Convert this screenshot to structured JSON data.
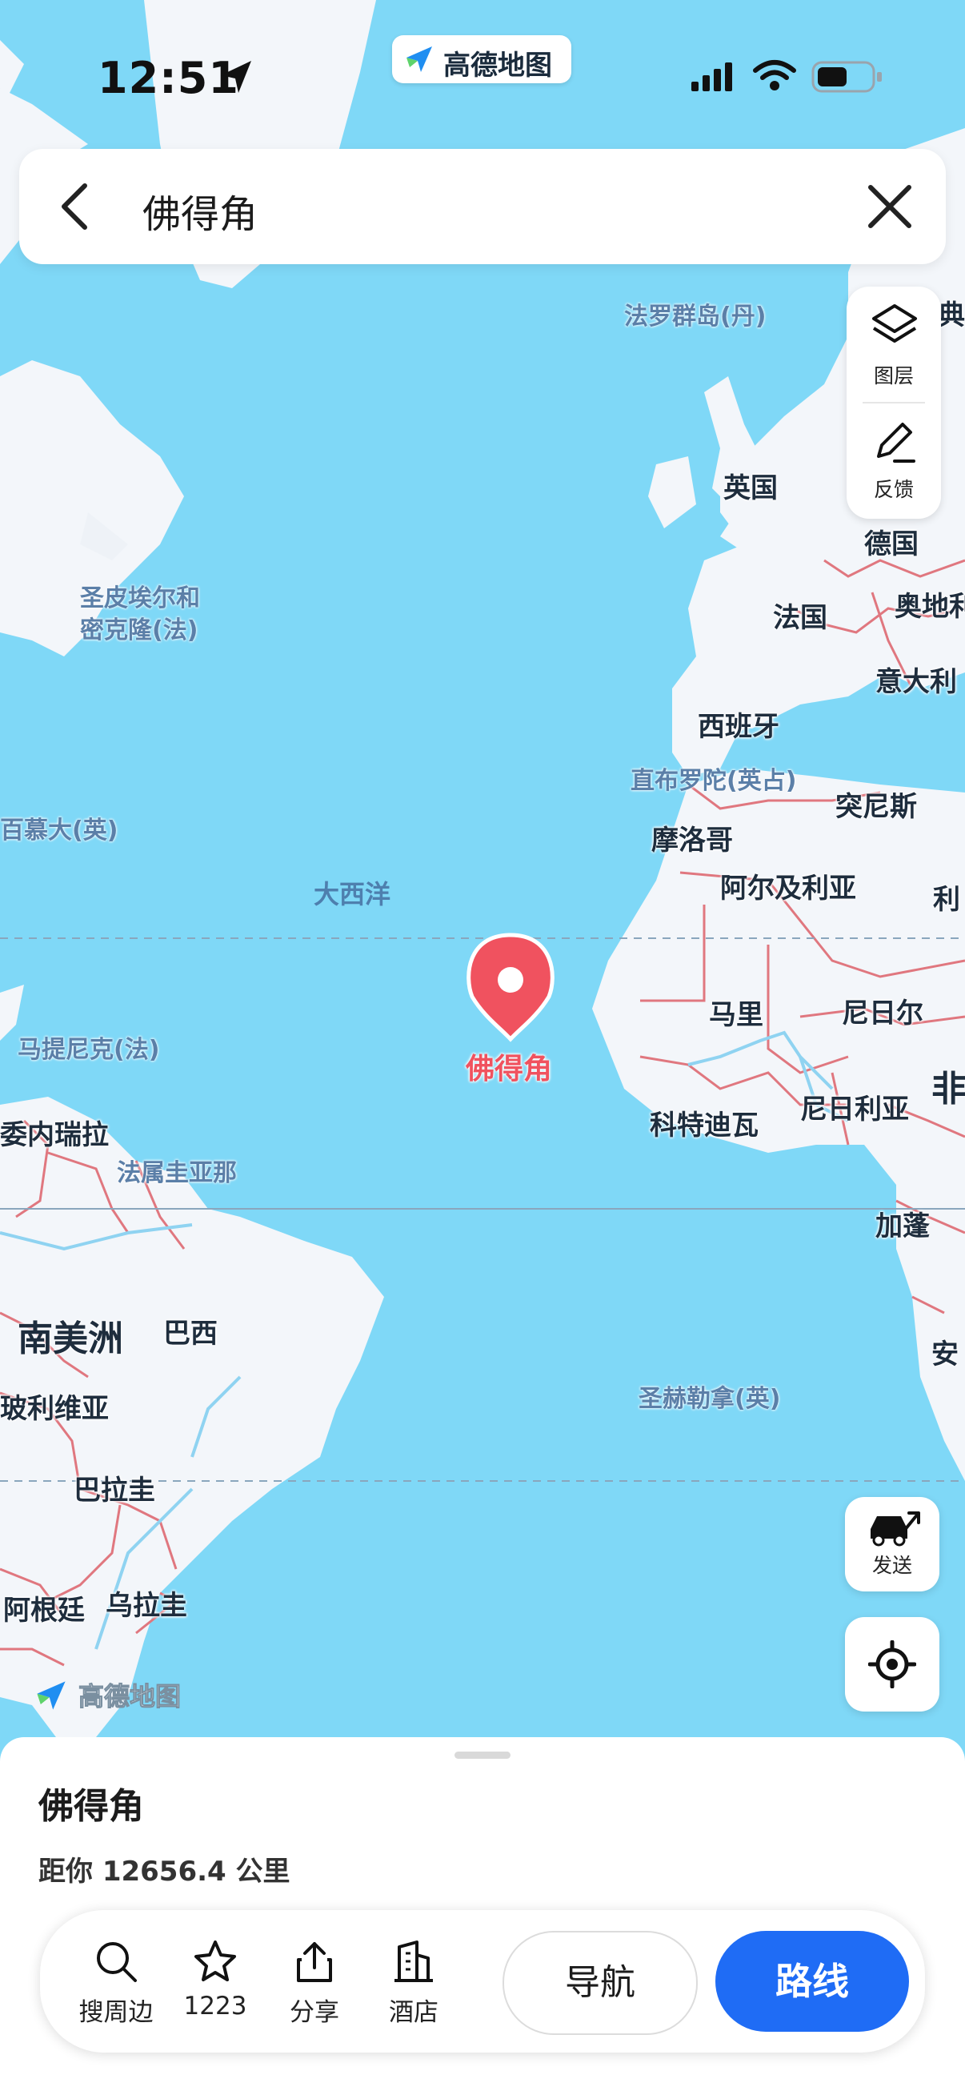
{
  "status_bar": {
    "time": "12:51",
    "app_name": "高德地图",
    "icons": [
      "location-arrow-icon",
      "signal-icon",
      "wifi-icon",
      "battery-icon"
    ]
  },
  "search": {
    "query": "佛得角",
    "back_icon": "chevron-left-icon",
    "clear_icon": "close-icon"
  },
  "side_tools": [
    {
      "label": "图层",
      "icon": "layers-icon"
    },
    {
      "label": "反馈",
      "icon": "pencil-icon"
    }
  ],
  "map_labels": {
    "faroe": "法罗群岛(丹)",
    "uk": "英国",
    "sweden_partial": "典",
    "germany": "德国",
    "austria": "奥地利",
    "france": "法国",
    "italy": "意大利",
    "spain": "西班牙",
    "gibraltar": "直布罗陀(英占)",
    "tunisia": "突尼斯",
    "morocco": "摩洛哥",
    "algeria": "阿尔及利亚",
    "libya_partial": "利",
    "mali": "马里",
    "niger": "尼日尔",
    "nigeria": "尼日利亚",
    "cote_divoire": "科特迪瓦",
    "africa_partial": "非",
    "gabon": "加蓬",
    "angola_partial": "安",
    "spm": "圣皮埃尔和\n密克隆(法)",
    "bermuda": "百慕大(英)",
    "atlantic": "大西洋",
    "martinique": "马提尼克(法)",
    "venezuela": "委内瑞拉",
    "french_guiana": "法属圭亚那",
    "south_america": "南美洲",
    "brazil": "巴西",
    "bolivia": "玻利维亚",
    "paraguay": "巴拉圭",
    "argentina": "阿根廷",
    "uruguay": "乌拉圭",
    "st_helena": "圣赫勒拿(英)"
  },
  "marker": {
    "label": "佛得角",
    "color": "#f0525f"
  },
  "map_buttons": [
    {
      "label": "发送",
      "icon": "car-send-icon"
    },
    {
      "label": "",
      "icon": "locate-icon"
    }
  ],
  "watermark": "高德地图",
  "place": {
    "name": "佛得角",
    "distance": "距你 12656.4 公里"
  },
  "actions": [
    {
      "label": "搜周边",
      "icon": "search-icon"
    },
    {
      "label": "1223",
      "icon": "star-icon"
    },
    {
      "label": "分享",
      "icon": "share-icon"
    },
    {
      "label": "酒店",
      "icon": "hotel-icon"
    }
  ],
  "buttons": {
    "navigate": "导航",
    "route": "路线"
  },
  "colors": {
    "ocean": "#7fd8f7",
    "land": "#f3f6fa",
    "border": "#e0777f",
    "accent": "#1f6cf5"
  }
}
